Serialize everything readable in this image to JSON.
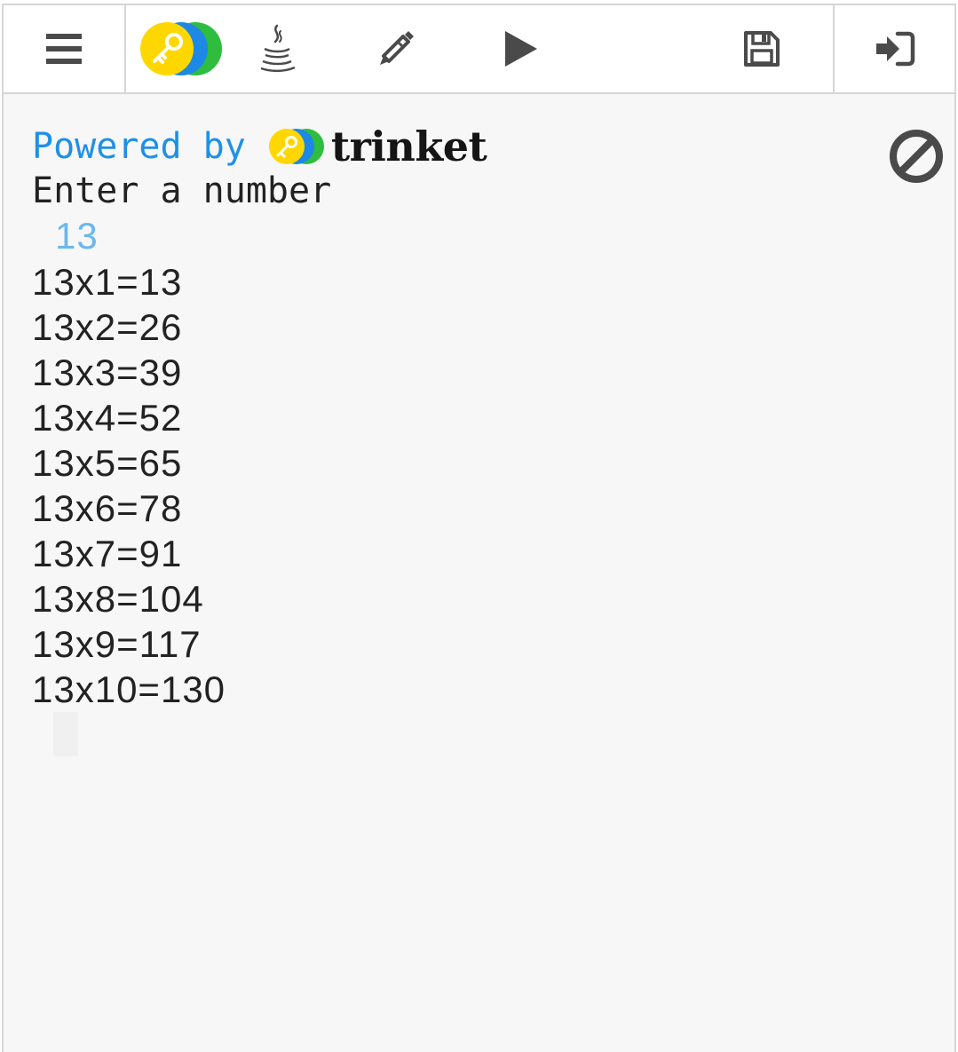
{
  "toolbar": {
    "menu_icon": "hamburger-menu-icon",
    "logo_icon": "trinket-key-logo-icon",
    "language_icon": "java-cup-icon",
    "edit_icon": "pencil-icon",
    "run_icon": "play-icon",
    "save_icon": "floppy-disk-icon",
    "login_icon": "sign-in-icon"
  },
  "console": {
    "powered_by": "Powered by",
    "brand": "trinket",
    "prompt": "Enter a number",
    "user_input": "13",
    "output": [
      "13x1=13",
      "13x2=26",
      "13x3=39",
      "13x4=52",
      "13x5=65",
      "13x6=78",
      "13x7=91",
      "13x8=104",
      "13x9=117",
      "13x10=130"
    ],
    "clear_icon": "ban-circle-icon"
  },
  "colors": {
    "powered_text": "#1e90e8",
    "input_echo": "#6ab8ee",
    "toolbar_icons": "#4a4a4a",
    "logo_yellow": "#ffd700",
    "logo_blue": "#1e88e5",
    "logo_green": "#2ebd3f"
  }
}
